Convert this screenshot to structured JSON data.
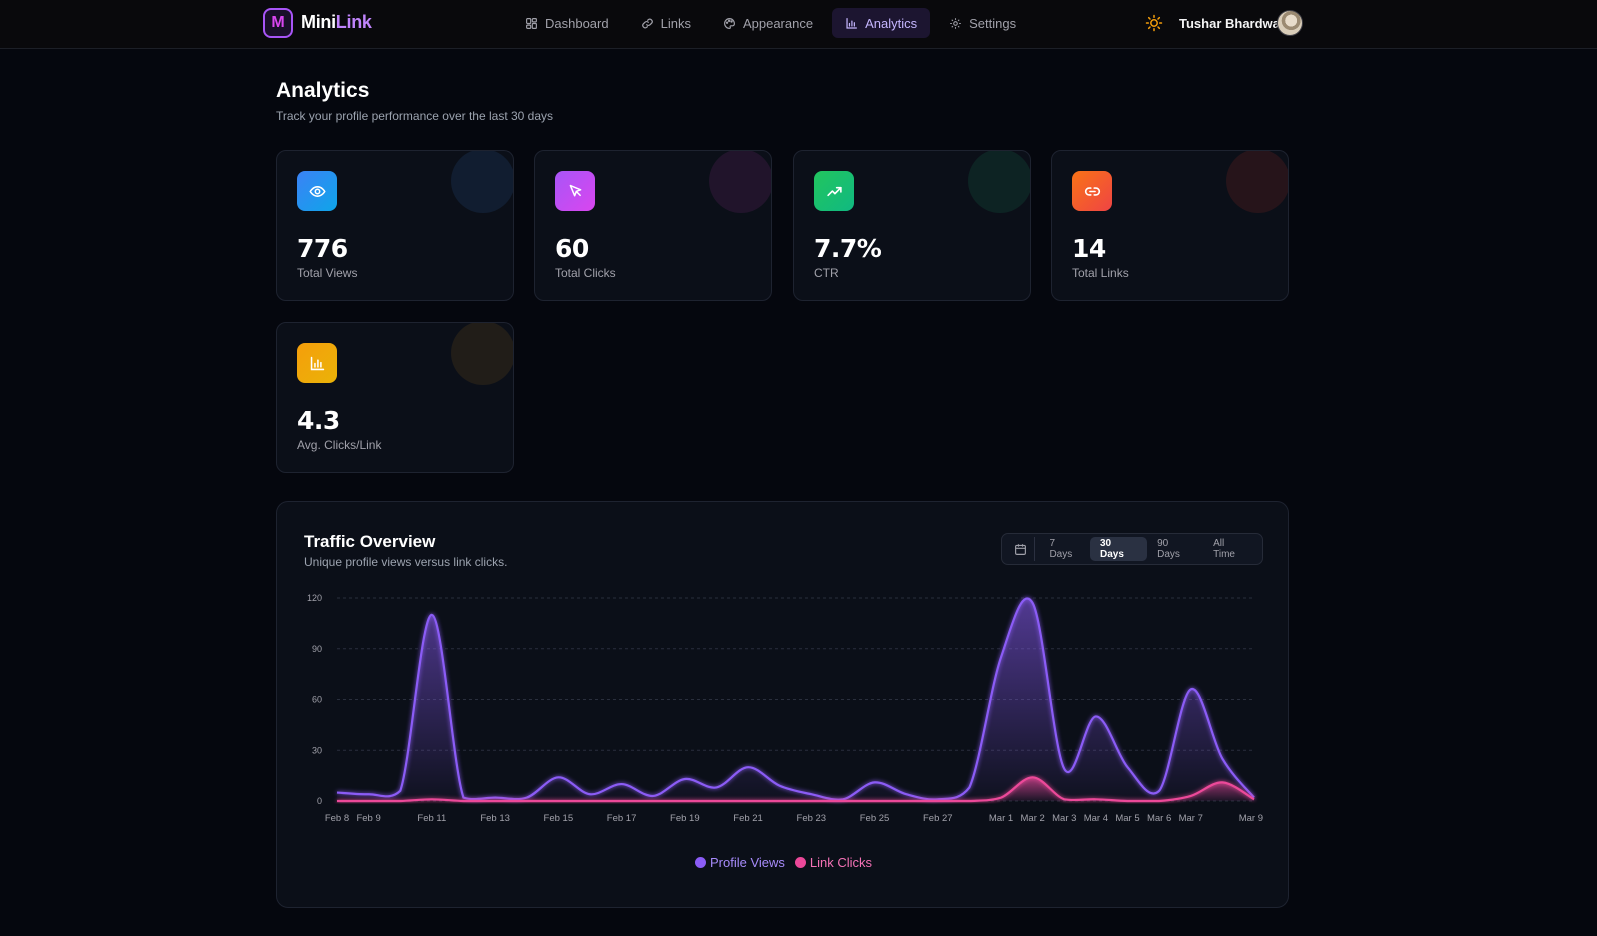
{
  "app": {
    "logo_letter": "M",
    "name_part1": "Mini",
    "name_part2": "Link"
  },
  "nav": [
    {
      "label": "Dashboard",
      "icon": "dashboard-icon",
      "active": false
    },
    {
      "label": "Links",
      "icon": "link-icon",
      "active": false
    },
    {
      "label": "Appearance",
      "icon": "palette-icon",
      "active": false
    },
    {
      "label": "Analytics",
      "icon": "bar-chart-icon",
      "active": true
    },
    {
      "label": "Settings",
      "icon": "gear-icon",
      "active": false
    }
  ],
  "user": {
    "name": "Tushar Bhardwaj"
  },
  "page": {
    "title": "Analytics",
    "subtitle": "Track your profile performance over the last 30 days"
  },
  "stats": [
    {
      "value": "776",
      "label": "Total Views",
      "icon": "eye-icon",
      "color": "#3b82f6"
    },
    {
      "value": "60",
      "label": "Total Clicks",
      "icon": "cursor-icon",
      "color": "#c026d3"
    },
    {
      "value": "7.7%",
      "label": "CTR",
      "icon": "trending-up-icon",
      "color": "#22c55e"
    },
    {
      "value": "14",
      "label": "Total Links",
      "icon": "link-icon",
      "color": "#f97316"
    },
    {
      "value": "4.3",
      "label": "Avg. Clicks/Link",
      "icon": "bar-chart-icon",
      "color": "#f59e0b"
    }
  ],
  "traffic": {
    "title": "Traffic Overview",
    "subtitle": "Unique profile views versus link clicks.",
    "ranges": [
      "7 Days",
      "30 Days",
      "90 Days",
      "All Time"
    ],
    "active_range": "30 Days"
  },
  "chart_data": {
    "type": "area",
    "x": [
      "Feb 8",
      "Feb 9",
      "Feb 10",
      "Feb 11",
      "Feb 12",
      "Feb 13",
      "Feb 14",
      "Feb 15",
      "Feb 16",
      "Feb 17",
      "Feb 18",
      "Feb 19",
      "Feb 20",
      "Feb 21",
      "Feb 22",
      "Feb 23",
      "Feb 24",
      "Feb 25",
      "Feb 26",
      "Feb 27",
      "Feb 28",
      "Mar 1",
      "Mar 2",
      "Mar 3",
      "Mar 4",
      "Mar 5",
      "Mar 6",
      "Mar 7",
      "Mar 8",
      "Mar 9"
    ],
    "x_tick_labels": [
      "Feb 8",
      "Feb 9",
      "Feb 11",
      "Feb 13",
      "Feb 15",
      "Feb 17",
      "Feb 19",
      "Feb 21",
      "Feb 23",
      "Feb 25",
      "Feb 27",
      "Mar 1",
      "Mar 2",
      "Mar 3",
      "Mar 4",
      "Mar 5",
      "Mar 6",
      "Mar 7",
      "Mar 9"
    ],
    "ylim": [
      0,
      120
    ],
    "yticks": [
      0,
      30,
      60,
      90,
      120
    ],
    "grid": true,
    "legend_position": "bottom-center",
    "series": [
      {
        "name": "Profile Views",
        "color": "#8b5cf6",
        "values": [
          5,
          4,
          6,
          110,
          2,
          2,
          2,
          14,
          4,
          10,
          3,
          13,
          8,
          20,
          9,
          4,
          1,
          11,
          4,
          1,
          8,
          85,
          117,
          19,
          50,
          20,
          6,
          66,
          25,
          2
        ]
      },
      {
        "name": "Link Clicks",
        "color": "#ec4899",
        "values": [
          0,
          0,
          0,
          1,
          0,
          0,
          0,
          0,
          0,
          0,
          0,
          0,
          0,
          0,
          0,
          0,
          0,
          0,
          0,
          0,
          0,
          2,
          14,
          1,
          1,
          0,
          0,
          3,
          11,
          1
        ]
      }
    ]
  }
}
